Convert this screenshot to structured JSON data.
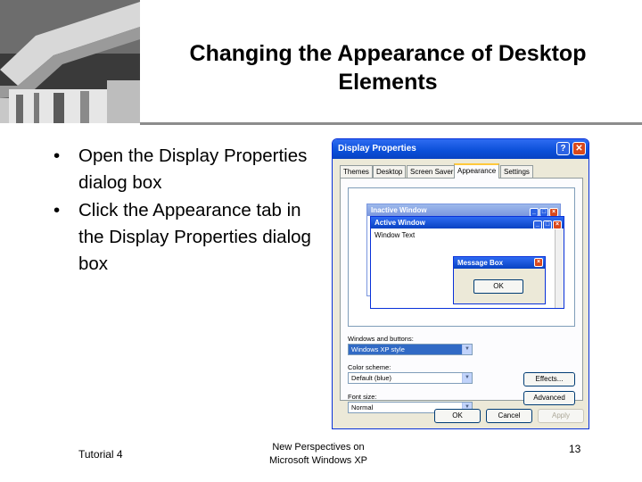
{
  "slide": {
    "title_line1": "Changing the Appearance of Desktop",
    "title_line2": "Elements",
    "bullets": [
      {
        "marker": "•",
        "text": "Open the Display Properties dialog box"
      },
      {
        "marker": "•",
        "text": "Click the Appearance tab in the Display Properties dialog box"
      }
    ],
    "footer": {
      "left": "Tutorial 4",
      "center_line1": "New Perspectives on",
      "center_line2": "Microsoft Windows XP",
      "page_number": "13"
    }
  },
  "dialog": {
    "title": "Display Properties",
    "help_button": "?",
    "close_button": "✕",
    "tabs": [
      {
        "label": "Themes",
        "active": false
      },
      {
        "label": "Desktop",
        "active": false
      },
      {
        "label": "Screen Saver",
        "active": false
      },
      {
        "label": "Appearance",
        "active": true
      },
      {
        "label": "Settings",
        "active": false
      }
    ],
    "preview": {
      "inactive_window_title": "Inactive Window",
      "active_window_title": "Active Window",
      "window_text": "Window Text",
      "message_box_title": "Message Box",
      "ok_label": "OK"
    },
    "windows_and_buttons": {
      "label": "Windows and buttons:",
      "value": "Windows XP style"
    },
    "color_scheme": {
      "label": "Color scheme:",
      "value": "Default (blue)"
    },
    "font_size": {
      "label": "Font size:",
      "value": "Normal"
    },
    "effects_label": "Effects...",
    "advanced_label": "Advanced",
    "ok_label": "OK",
    "cancel_label": "Cancel",
    "apply_label": "Apply"
  },
  "colors": {
    "xp_title_blue": "#0a4fd8",
    "xp_close_red": "#d9481c",
    "dialog_face": "#ece9d8",
    "selection_blue": "#316ac5"
  }
}
